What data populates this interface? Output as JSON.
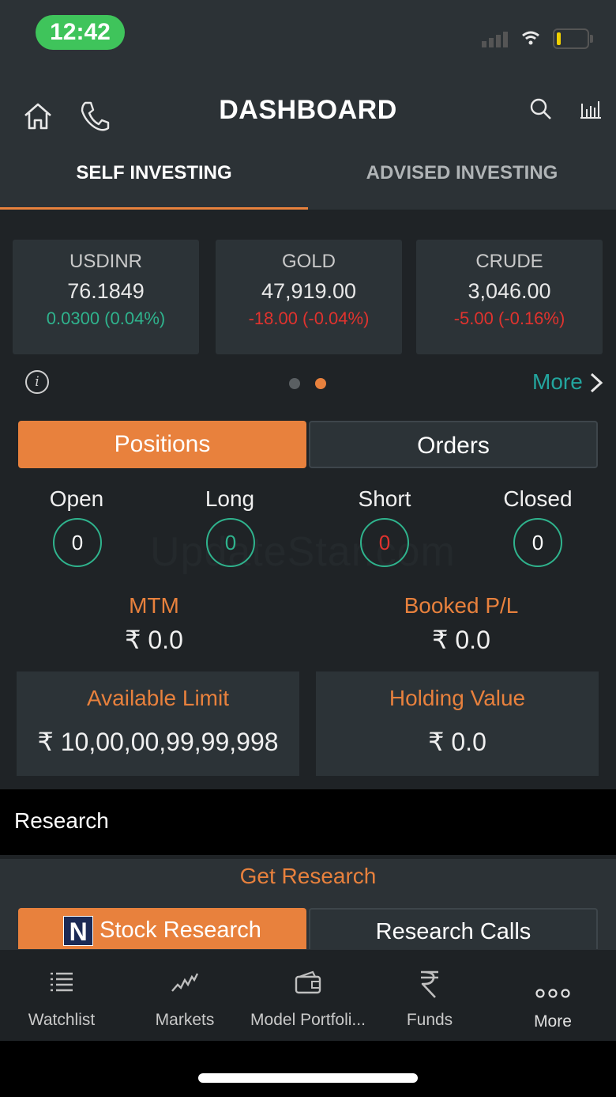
{
  "status": {
    "time": "12:42"
  },
  "header": {
    "title": "DASHBOARD"
  },
  "tabs": [
    {
      "label": "SELF INVESTING"
    },
    {
      "label": "ADVISED INVESTING"
    }
  ],
  "tickers": [
    {
      "symbol": "USDINR",
      "price": "76.1849",
      "change": "0.0300 (0.04%)"
    },
    {
      "symbol": "GOLD",
      "price": "47,919.00",
      "change": "-18.00 (-0.04%)"
    },
    {
      "symbol": "CRUDE",
      "price": "3,046.00",
      "change": "-5.00 (-0.16%)"
    }
  ],
  "more_label": "More",
  "toggle": {
    "positions": "Positions",
    "orders": "Orders"
  },
  "counters": [
    {
      "label": "Open",
      "value": "0"
    },
    {
      "label": "Long",
      "value": "0"
    },
    {
      "label": "Short",
      "value": "0"
    },
    {
      "label": "Closed",
      "value": "0"
    }
  ],
  "pl": [
    {
      "label": "MTM",
      "value": "₹ 0.0"
    },
    {
      "label": "Booked P/L",
      "value": "₹ 0.0"
    }
  ],
  "limits": [
    {
      "label": "Available Limit",
      "value": "₹ 10,00,00,99,99,998"
    },
    {
      "label": "Holding Value",
      "value": "₹ 0.0"
    }
  ],
  "research": {
    "title": "Research",
    "get_research": "Get Research",
    "stock_research": "Stock Research",
    "logo_letter": "N",
    "research_calls": "Research Calls"
  },
  "nav": [
    {
      "label": "Watchlist",
      "icon": "list-icon"
    },
    {
      "label": "Markets",
      "icon": "chart-line-icon"
    },
    {
      "label": "Model Portfoli...",
      "icon": "wallet-icon"
    },
    {
      "label": "Funds",
      "icon": "rupee-icon"
    },
    {
      "label": "More",
      "icon": "more-dots-icon"
    }
  ],
  "watermark": "UpdateStar.com",
  "colors": {
    "accent": "#e8813d",
    "positive": "#2fb38d",
    "negative": "#e0332e",
    "link": "#23a59e"
  }
}
